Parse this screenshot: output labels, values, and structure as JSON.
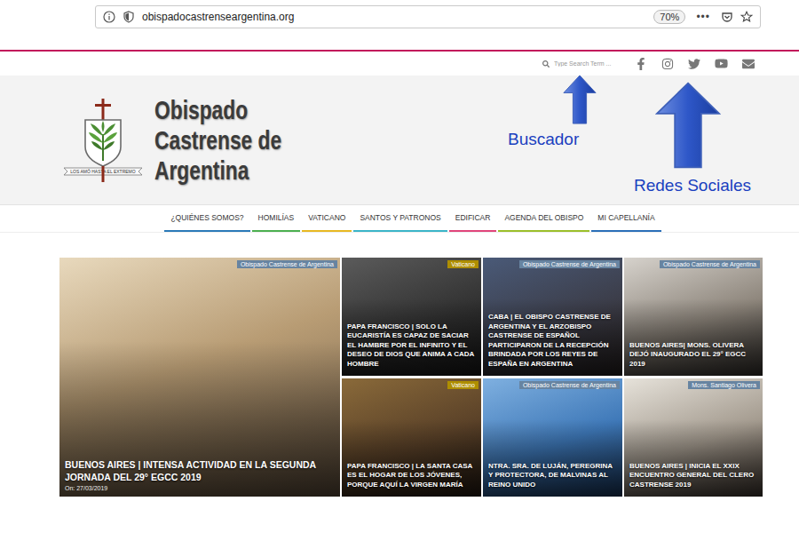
{
  "browser": {
    "url": "obispadocastrenseargentina.org",
    "zoom": "70%",
    "menu": "•••"
  },
  "search": {
    "placeholder": "Type Search Term ..."
  },
  "logo": {
    "motto": "LOS AMÓ HASTA EL EXTREMO",
    "title_lines": [
      "Obispado",
      "Castrense de",
      "Argentina"
    ]
  },
  "annotations": [
    {
      "label": "Buscador"
    },
    {
      "label": "Redes Sociales"
    }
  ],
  "nav": [
    {
      "label": "¿QUIÉNES SOMOS?",
      "color": "#2a7ab8"
    },
    {
      "label": "HOMILÍAS",
      "color": "#4caf50"
    },
    {
      "label": "VATICANO",
      "color": "#e8b923"
    },
    {
      "label": "SANTOS Y PATRONOS",
      "color": "#3bb5c8"
    },
    {
      "label": "EDIFICAR",
      "color": "#e0457b"
    },
    {
      "label": "AGENDA DEL OBISPO",
      "color": "#9bbf2a"
    },
    {
      "label": "MI CAPELLANÍA",
      "color": "#2a6fb8"
    }
  ],
  "posts": [
    {
      "category": "Obispado Castrense de Argentina",
      "color": "#8fb8e0",
      "title": "BUENOS AIRES | INTENSA ACTIVIDAD EN LA SEGUNDA JORNADA DEL 29° EGCC 2019",
      "date": "On: 27/03/2019"
    },
    {
      "category": "Vaticano",
      "color": "#f2c500",
      "title": "PAPA FRANCISCO | SOLO LA EUCARISTÍA ES CAPAZ DE SACIAR EL HAMBRE POR EL INFINITO Y EL DESEO DE DIOS QUE ANIMA A CADA HOMBRE"
    },
    {
      "category": "Obispado Castrense de Argentina",
      "color": "#8fb8e0",
      "title": "CABA | EL OBISPO CASTRENSE DE ARGENTINA Y EL ARZOBISPO CASTRENSE DE ESPAÑOL PARTICIPARON DE LA RECEPCIÓN BRINDADA POR LOS REYES DE ESPAÑA EN ARGENTINA"
    },
    {
      "category": "Obispado Castrense de Argentina",
      "color": "#8fb8e0",
      "title": "BUENOS AIRES| MONS. OLIVERA DEJÓ INAUGURADO EL 29° EGCC 2019"
    },
    {
      "category": "Vaticano",
      "color": "#f2c500",
      "title": "PAPA FRANCISCO | LA SANTA CASA ES EL HOGAR DE LOS JÓVENES, PORQUE AQUÍ LA VIRGEN MARÍA"
    },
    {
      "category": "Obispado Castrense de Argentina",
      "color": "#8fb8e0",
      "title": "NTRA. SRA. DE LUJÁN, PEREGRINA Y PROTECTORA, DE MALVINAS AL REINO UNIDO"
    },
    {
      "category": "Mons. Santiago Olivera",
      "color": "#8fb8e0",
      "title": "BUENOS AIRES | INICIA EL XXIX ENCUENTRO GENERAL DEL CLERO CASTRENSE 2019"
    }
  ]
}
